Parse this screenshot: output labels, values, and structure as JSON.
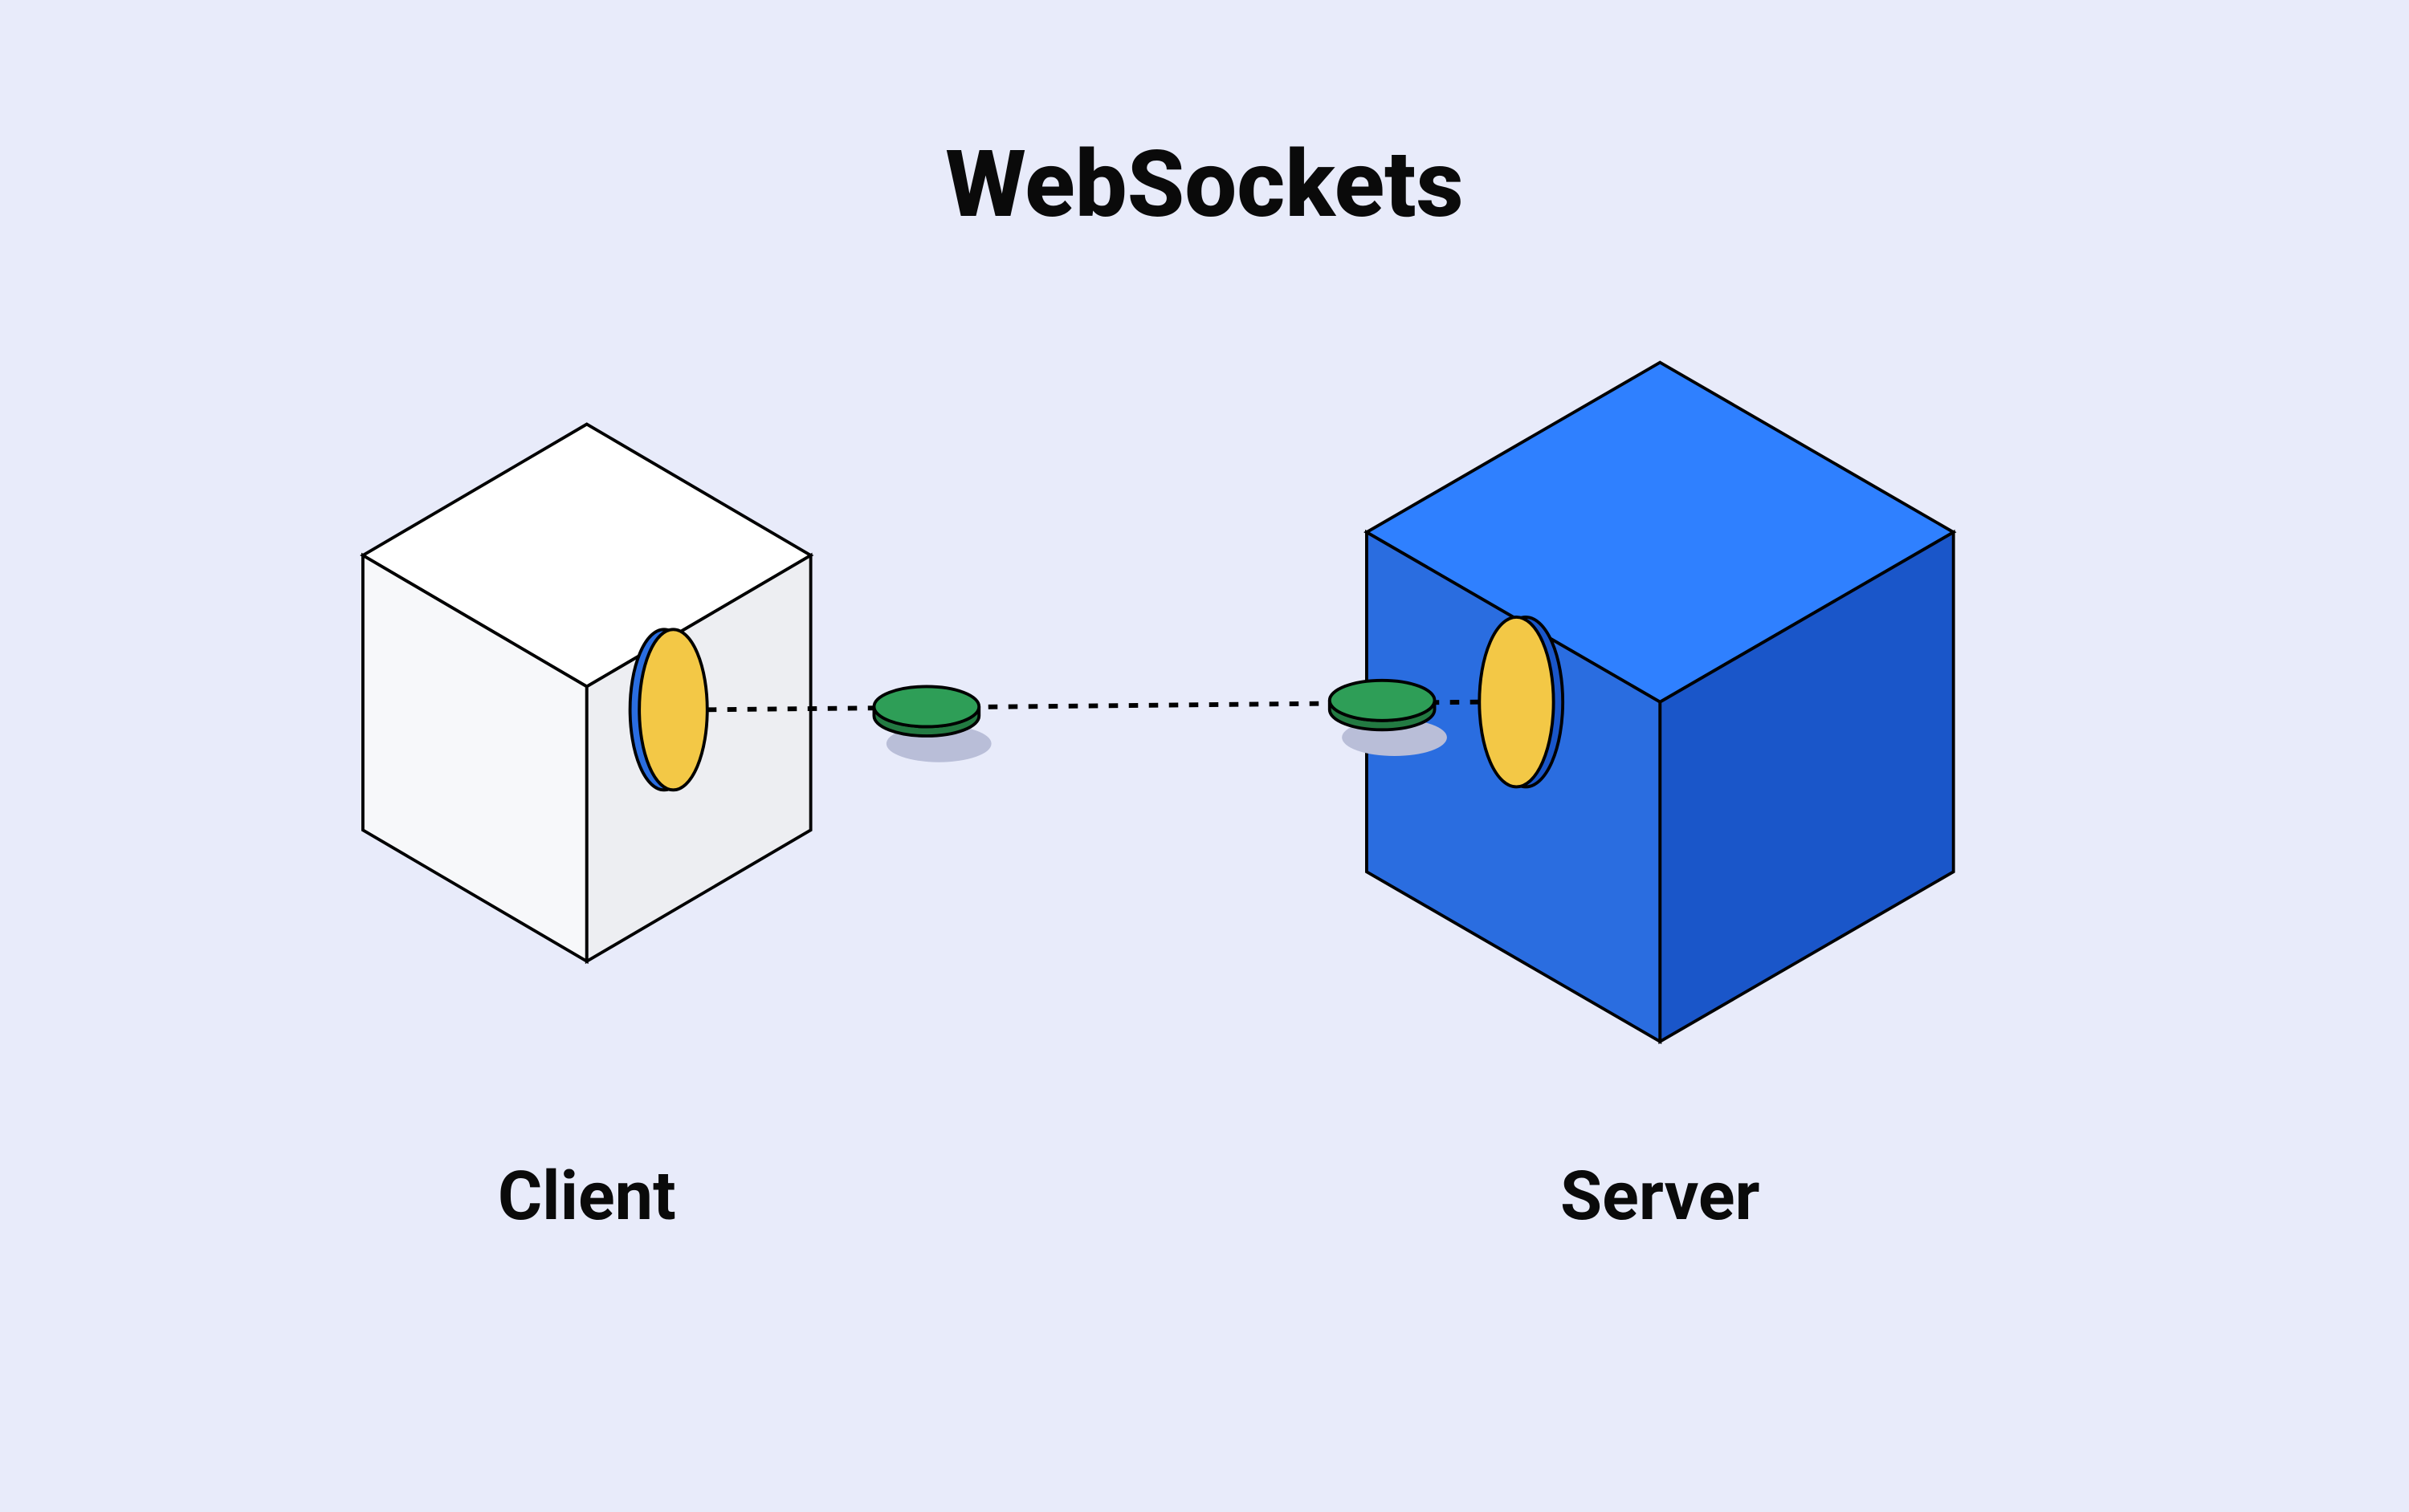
{
  "title": "WebSockets",
  "left_label": "Client",
  "right_label": "Server",
  "colors": {
    "background": "#e8ebfa",
    "client_top": "#ffffff",
    "client_left": "#f7f8fa",
    "client_right": "#edeef2",
    "server_top": "#2f80ff",
    "server_left": "#2a6de0",
    "server_right": "#1a56c9",
    "port_blue": "#2a6de0",
    "port_yellow": "#f3c846",
    "packet_green": "#2e9e57",
    "packet_green_side": "#237a42",
    "shadow": "#b9bed8",
    "stroke": "#000000"
  }
}
